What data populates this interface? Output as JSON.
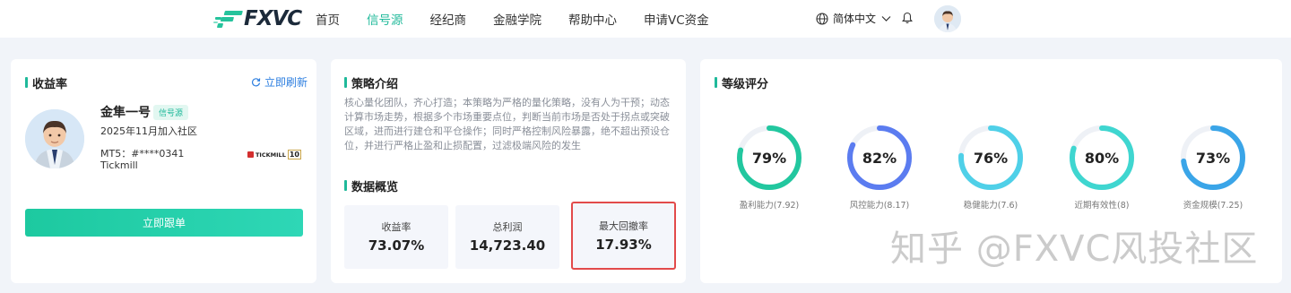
{
  "header": {
    "logo_text": "FXVC",
    "nav": [
      "首页",
      "信号源",
      "经纪商",
      "金融学院",
      "帮助中心",
      "申请VC资金"
    ],
    "active_index": 1,
    "language": "简体中文"
  },
  "profit_card": {
    "title": "收益率",
    "refresh_label": "立即刷新",
    "name": "金隼一号",
    "badge": "信号源",
    "joined": "2025年11月加入社区",
    "account": "MT5：#****0341",
    "broker": "Tickmill",
    "broker_logo_text": "TICKMILL",
    "broker_logo_badge": "10",
    "follow_button": "立即跟单"
  },
  "strategy_card": {
    "title": "策略介绍",
    "description": "核心量化团队，齐心打造；本策略为严格的量化策略，没有人为干预；动态计算市场走势，根据多个市场重要点位，判断当前市场是否处于拐点或突破区域，进而进行建仓和平仓操作；同时严格控制风险暴露，绝不超出预设仓位，并进行严格止盈和止损配置，过滤极端风险的发生",
    "overview_title": "数据概览",
    "stats": [
      {
        "label": "收益率",
        "value": "73.07%"
      },
      {
        "label": "总利润",
        "value": "14,723.40"
      },
      {
        "label": "最大回撤率",
        "value": "17.93%"
      }
    ]
  },
  "rating_card": {
    "title": "等级评分",
    "ratings": [
      {
        "pct": "79%",
        "value": 79,
        "label": "盈利能力(7.92)",
        "color": "#22c79f"
      },
      {
        "pct": "82%",
        "value": 82,
        "label": "风控能力(8.17)",
        "color": "#5b7cf0"
      },
      {
        "pct": "76%",
        "value": 76,
        "label": "稳健能力(7.6)",
        "color": "#4fd0e8"
      },
      {
        "pct": "80%",
        "value": 80,
        "label": "近期有效性(8)",
        "color": "#3fd6d0"
      },
      {
        "pct": "73%",
        "value": 73,
        "label": "资金规模(7.25)",
        "color": "#3aa5e8"
      }
    ]
  },
  "watermark": "知乎 @FXVC风投社区",
  "colors": {
    "accent": "#1fb99a",
    "link": "#2e7fe0",
    "highlight_border": "#e24a4a"
  }
}
